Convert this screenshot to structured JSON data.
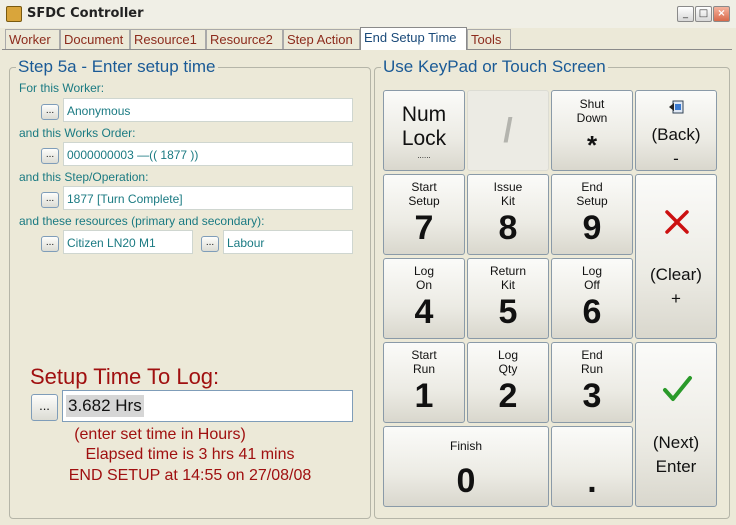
{
  "window": {
    "title": "SFDC Controller"
  },
  "tabs": [
    {
      "label": "Worker",
      "active": false
    },
    {
      "label": "Document",
      "active": false
    },
    {
      "label": "Resource1",
      "active": false
    },
    {
      "label": "Resource2",
      "active": false
    },
    {
      "label": "Step Action",
      "active": false
    },
    {
      "label": "End Setup Time",
      "active": true
    },
    {
      "label": "Tools",
      "active": false
    }
  ],
  "step_panel": {
    "title": "Step 5a - Enter setup time",
    "worker_label": "For this Worker:",
    "worker_value": "Anonymous",
    "order_label": "and this Works Order:",
    "order_value": "0000000003    —(( 1877 ))",
    "step_label": "and this Step/Operation:",
    "step_value": "1877 [Turn Complete]",
    "resources_label": "and these resources (primary and secondary):",
    "resource_primary": "Citizen LN20 M1",
    "resource_secondary": "Labour",
    "browse_label": "..."
  },
  "setup": {
    "label": "Setup Time To Log:",
    "browse_label": "...",
    "value": "3.682 Hrs",
    "hint": "(enter set time in Hours)",
    "elapsed": "Elapsed time is 3 hrs 41 mins",
    "end_setup": "END SETUP at 14:55 on 27/08/08"
  },
  "keypad": {
    "title": "Use KeyPad or Touch Screen",
    "numlock_line1": "Num",
    "numlock_line2": "Lock",
    "numlock_sub": "......",
    "slash": "/",
    "shutdown_line1": "Shut",
    "shutdown_line2": "Down",
    "shutdown_key": "*",
    "back_label": "(Back)",
    "back_key": "-",
    "k7_line1": "Start",
    "k7_line2": "Setup",
    "k7": "7",
    "k8_line1": "Issue",
    "k8_line2": "Kit",
    "k8": "8",
    "k9_line1": "End",
    "k9_line2": "Setup",
    "k9": "9",
    "clear_label": "(Clear)",
    "clear_key": "+",
    "k4_line1": "Log",
    "k4_line2": "On",
    "k4": "4",
    "k5_line1": "Return",
    "k5_line2": "Kit",
    "k5": "5",
    "k6_line1": "Log",
    "k6_line2": "Off",
    "k6": "6",
    "k1_line1": "Start",
    "k1_line2": "Run",
    "k1": "1",
    "k2_line1": "Log",
    "k2_line2": "Qty",
    "k2": "2",
    "k3_line1": "End",
    "k3_line2": "Run",
    "k3": "3",
    "next_label": "(Next)",
    "enter_label": "Enter",
    "k0_line1": "Finish",
    "k0": "0",
    "dot": "."
  },
  "colors": {
    "accent_title": "#1a5a96",
    "label_teal": "#1a7a82",
    "status_red": "#a01010",
    "clear_red": "#cc1010",
    "enter_green": "#2a9a2a"
  }
}
